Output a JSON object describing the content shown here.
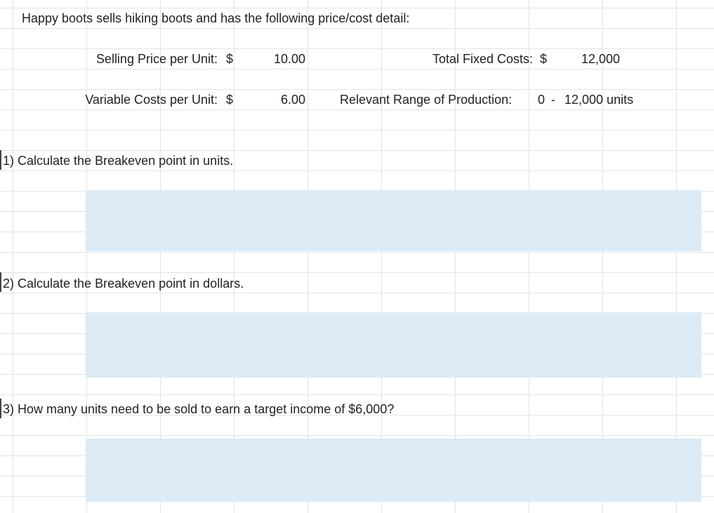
{
  "intro": "Happy boots sells hiking boots and has the following price/cost detail:",
  "selling_price": {
    "label": "Selling Price per Unit:",
    "currency": "$",
    "value": "10.00"
  },
  "variable_costs": {
    "label": "Variable Costs per Unit:",
    "currency": "$",
    "value": "6.00"
  },
  "fixed_costs": {
    "label": "Total Fixed Costs:",
    "currency": "$",
    "value": "12,000"
  },
  "relevant_range": {
    "label": "Relevant Range of Production:",
    "low": "0",
    "dash": "-",
    "high": "12,000 units"
  },
  "questions": [
    {
      "text": "1) Calculate the Breakeven point in units."
    },
    {
      "text": "2) Calculate the Breakeven point in dollars."
    },
    {
      "text": "3) How many units need to be sold to earn a target income of $6,000?"
    }
  ],
  "colors": {
    "answer_fill": "#ddebf7",
    "gridline": "#e3e3e3"
  }
}
